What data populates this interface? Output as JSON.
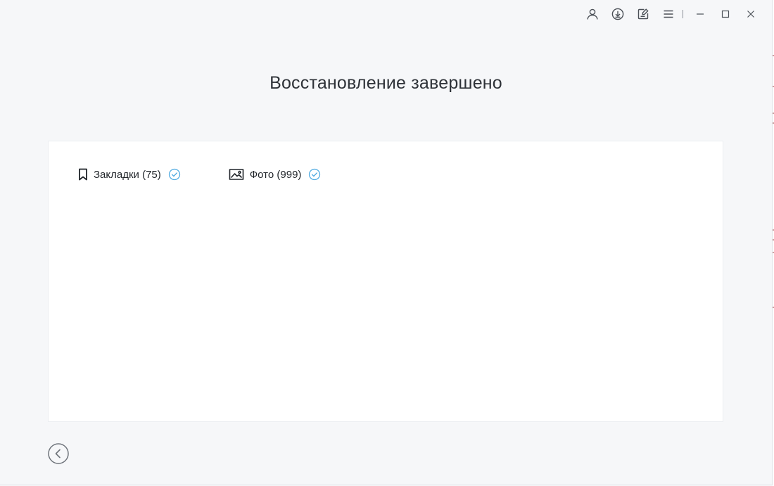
{
  "window": {
    "title": "Восстановление завершено"
  },
  "titlebar": {
    "icons": [
      "user-icon",
      "download-icon",
      "feedback-icon",
      "menu-icon",
      "minimize-icon",
      "maximize-icon",
      "close-icon"
    ]
  },
  "results": {
    "items": [
      {
        "icon": "bookmark-icon",
        "label": "Закладки (75)",
        "status": "check-icon"
      },
      {
        "icon": "photo-icon",
        "label": "Фото (999)",
        "status": "check-icon"
      }
    ]
  },
  "footer": {
    "back_icon": "back-arrow-icon"
  },
  "colors": {
    "background": "#f6f7f9",
    "panel": "#ffffff",
    "check_accent": "#4aa8e0",
    "text": "#2e3238"
  }
}
